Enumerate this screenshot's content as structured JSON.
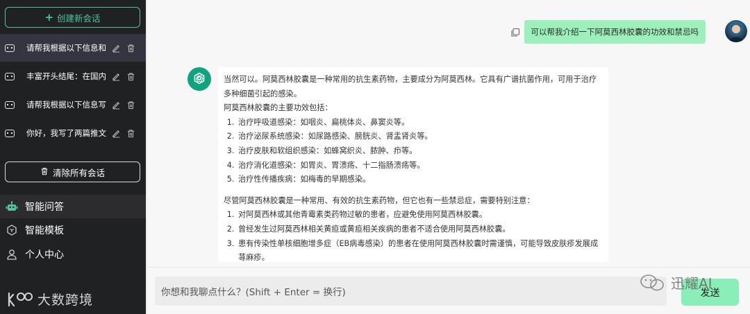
{
  "sidebar": {
    "new_chat_label": "创建新会话",
    "conversations": [
      {
        "title": "请帮我根据以下信息和"
      },
      {
        "title": "丰富开头结尾：在国内"
      },
      {
        "title": "请帮我根据以下信息写"
      },
      {
        "title": "你好，我写了两篇推文"
      }
    ],
    "clear_all_label": "清除所有会话",
    "nav": [
      {
        "label": "智能问答",
        "icon": "robot-icon"
      },
      {
        "label": "智能模板",
        "icon": "hexagon-icon"
      },
      {
        "label": "个人中心",
        "icon": "user-icon"
      }
    ],
    "brand": "大数跨境",
    "accent": "#53c39a"
  },
  "chat": {
    "user_message": "可以帮我介绍一下阿莫西林胶囊的功效和禁忌吗",
    "answer": {
      "intro": "当然可以。阿莫西林胶囊是一种常用的抗生素药物，主要成分为阿莫西林。它具有广谱抗菌作用，可用于治疗多种细菌引起的感染。",
      "effects_heading": "阿莫西林胶囊的主要功效包括：",
      "effects": [
        "治疗呼吸道感染：如咽炎、扁桃体炎、鼻窦炎等。",
        "治疗泌尿系统感染：如尿路感染、膀胱炎、肾盂肾炎等。",
        "治疗皮肤和软组织感染：如蜂窝织炎、脓肿、疖等。",
        "治疗消化道感染：如胃炎、胃溃疡、十二指肠溃疡等。",
        "治疗性传播疾病：如梅毒的早期感染。"
      ],
      "contra_heading": "尽管阿莫西林胶囊是一种常用、有效的抗生素药物，但它也有一些禁忌症，需要特别注意：",
      "contraindications": [
        "对阿莫西林或其他青霉素类药物过敏的患者，应避免使用阿莫西林胶囊。",
        "曾经发生过阿莫西林相关黄疸或黄疸相关疾病的患者不适合使用阿莫西林胶囊。",
        "患有传染性单核细胞增多症（EB病毒感染）的患者在使用阿莫西林胶囊时需谨慎，可能导致皮肤疹发展成荨麻疹。"
      ]
    }
  },
  "input": {
    "placeholder": "你想和我聊点什么？(Shift + Enter = 换行)",
    "send_label": "发送"
  },
  "watermark": "迅耀AI"
}
